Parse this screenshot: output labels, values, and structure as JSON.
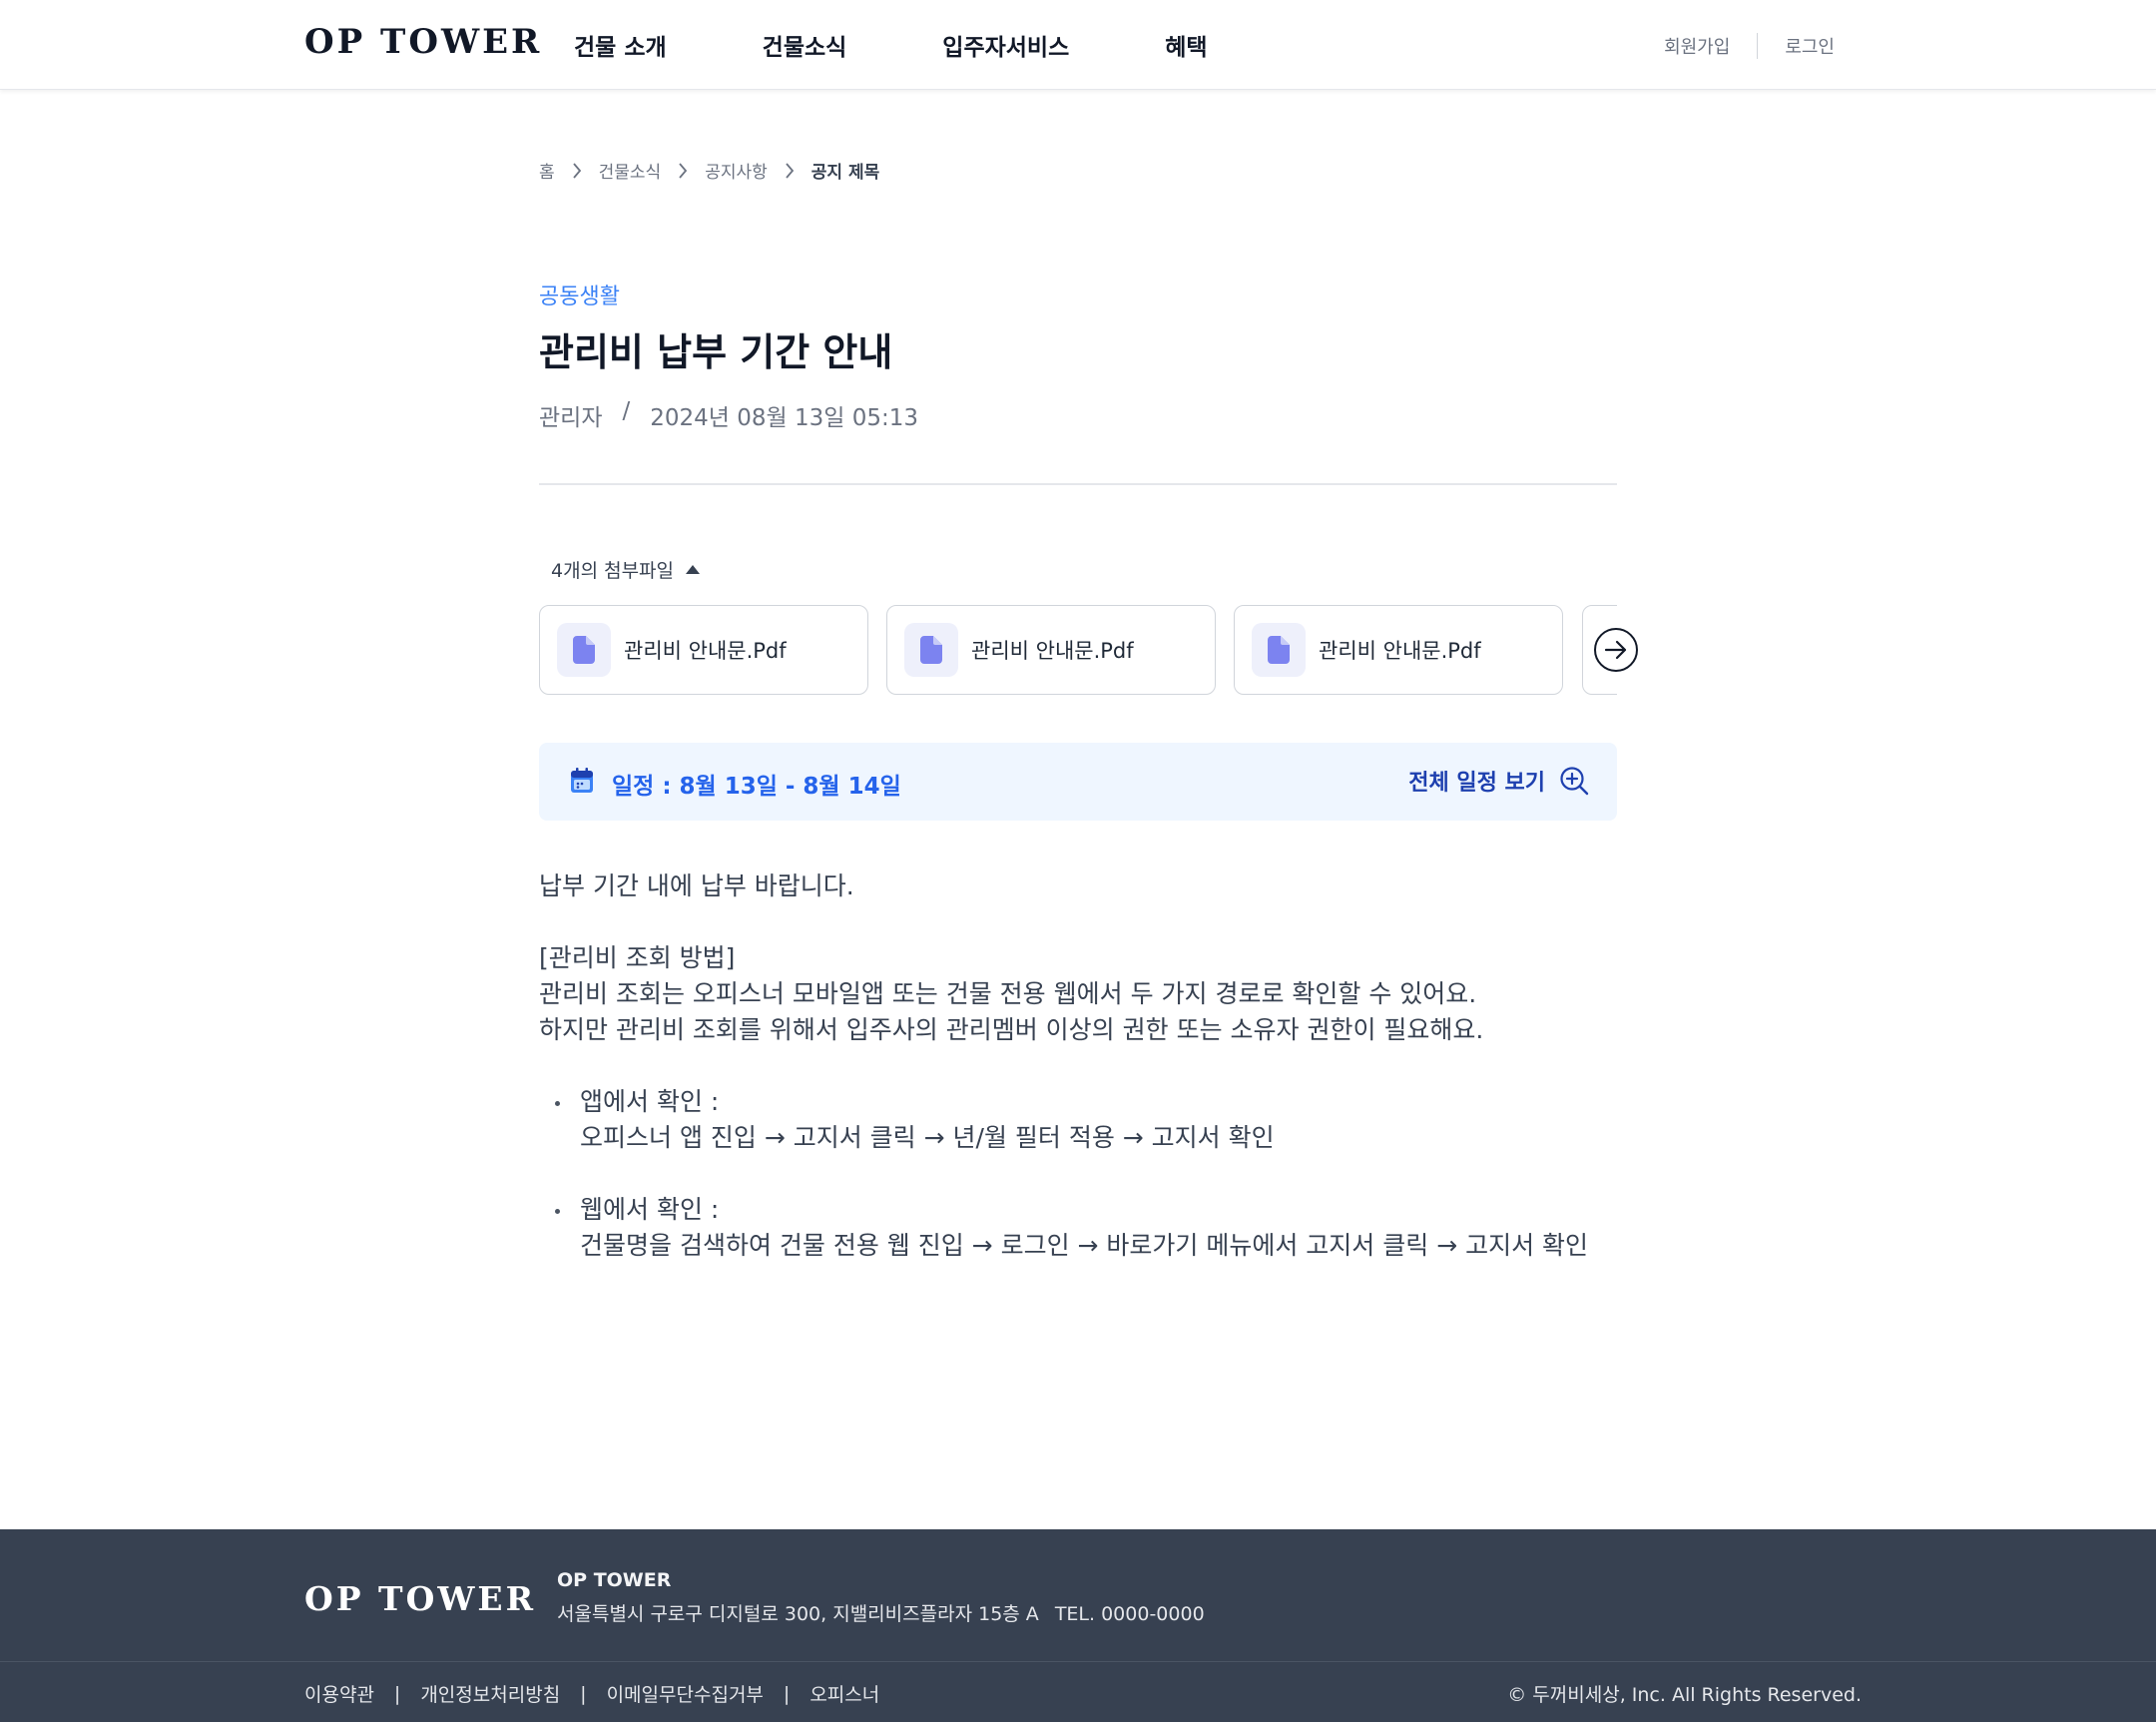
{
  "header": {
    "logo": "OP TOWER",
    "nav": [
      "건물 소개",
      "건물소식",
      "입주자서비스",
      "혜택"
    ],
    "signup_label": "회원가입",
    "login_label": "로그인"
  },
  "breadcrumb": [
    "홈",
    "건물소식",
    "공지사항",
    "공지 제목"
  ],
  "post": {
    "category": "공동생활",
    "title": "관리비 납부 기간 안내",
    "author": "관리자",
    "date": "2024년 08월 13일 05:13"
  },
  "attachments": {
    "toggle_label": "4개의 첨부파일",
    "files": [
      "관리비 안내문.Pdf",
      "관리비 안내문.Pdf",
      "관리비 안내문.Pdf"
    ],
    "icon": "document-icon",
    "next_icon": "arrow-right-icon"
  },
  "schedule": {
    "text": "일정 : 8월 13일 - 8월 14일",
    "view_all_label": "전체 일정 보기",
    "calendar_icon": "calendar-icon",
    "zoom_icon": "zoom-in-icon"
  },
  "body": {
    "intro": "납부 기간 내에 납부 바랍니다.",
    "section_title": "[관리비 조회 방법]",
    "line1": "관리비 조회는 오피스너 모바일앱 또는 건물 전용 웹에서 두 가지 경로로 확인할 수 있어요.",
    "line2": "하지만 관리비 조회를 위해서 입주사의 관리멤버 이상의 권한 또는 소유자 권한이 필요해요.",
    "bullets": [
      {
        "title": "앱에서 확인 :",
        "text": "오피스너 앱 진입 → 고지서 클릭 → 년/월 필터 적용 → 고지서 확인"
      },
      {
        "title": "웹에서 확인 :",
        "text": "건물명을 검색하여 건물 전용 웹 진입 → 로그인 → 바로가기 메뉴에서 고지서 클릭 → 고지서 확인"
      }
    ]
  },
  "footer": {
    "logo": "OP TOWER",
    "company": "OP TOWER",
    "address": "서울특별시 구로구 디지털로 300, 지밸리비즈플라자 15층 A",
    "tel": "TEL. 0000-0000",
    "links": [
      "이용약관",
      "개인정보처리방침",
      "이메일무단수집거부",
      "오피스너"
    ],
    "separator": "|",
    "copyright": "© 두꺼비세상, Inc. All Rights Reserved."
  },
  "colors": {
    "accent": "#3b82f6",
    "schedule_bg": "#eff6ff",
    "footer_bg": "#374151",
    "file_icon": "#7c83f0"
  }
}
